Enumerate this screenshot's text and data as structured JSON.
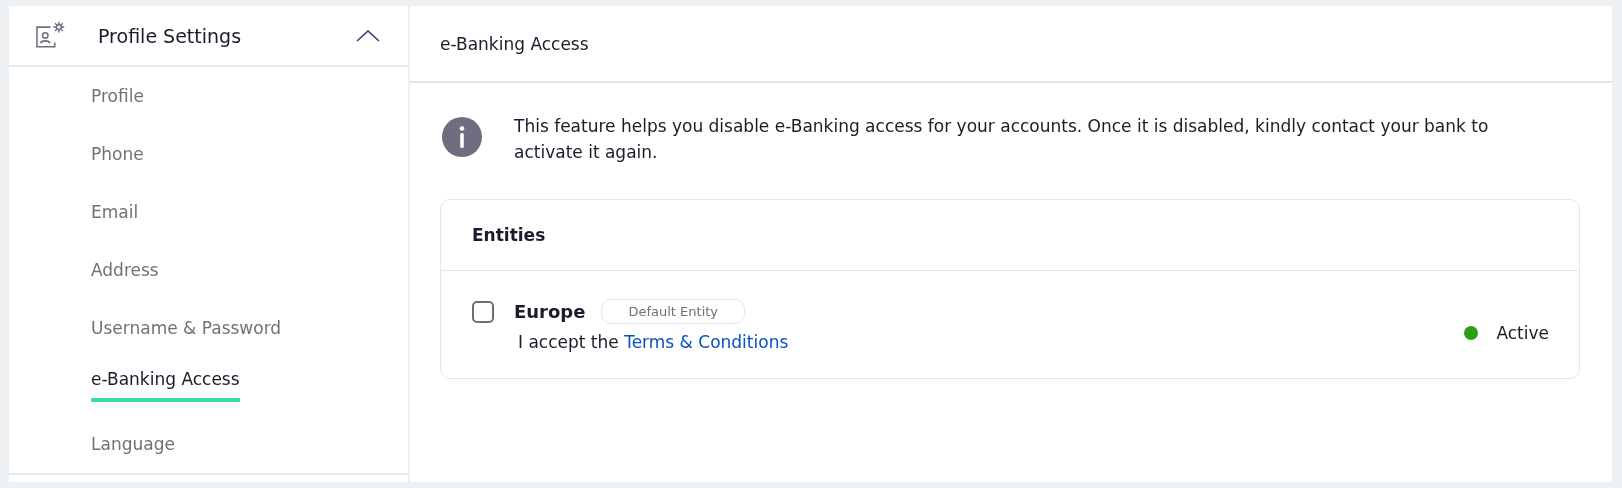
{
  "sidebar": {
    "title": "Profile Settings",
    "expanded": true,
    "items": [
      {
        "label": "Profile",
        "selected": false
      },
      {
        "label": "Phone",
        "selected": false
      },
      {
        "label": "Email",
        "selected": false
      },
      {
        "label": "Address",
        "selected": false
      },
      {
        "label": "Username & Password",
        "selected": false
      },
      {
        "label": "e-Banking Access",
        "selected": true
      },
      {
        "label": "Language",
        "selected": false
      }
    ]
  },
  "main": {
    "title": "e-Banking Access",
    "info": "This feature helps you disable e-Banking access for your accounts. Once it is disabled, kindly contact your bank to activate it again.",
    "entities": {
      "title": "Entities",
      "rows": [
        {
          "name": "Europe",
          "badge": "Default Entity",
          "checked": false,
          "terms_prefix": "I accept the",
          "terms_link": "Terms & Conditions",
          "status": "Active",
          "color": "#2e9e12"
        }
      ]
    }
  }
}
